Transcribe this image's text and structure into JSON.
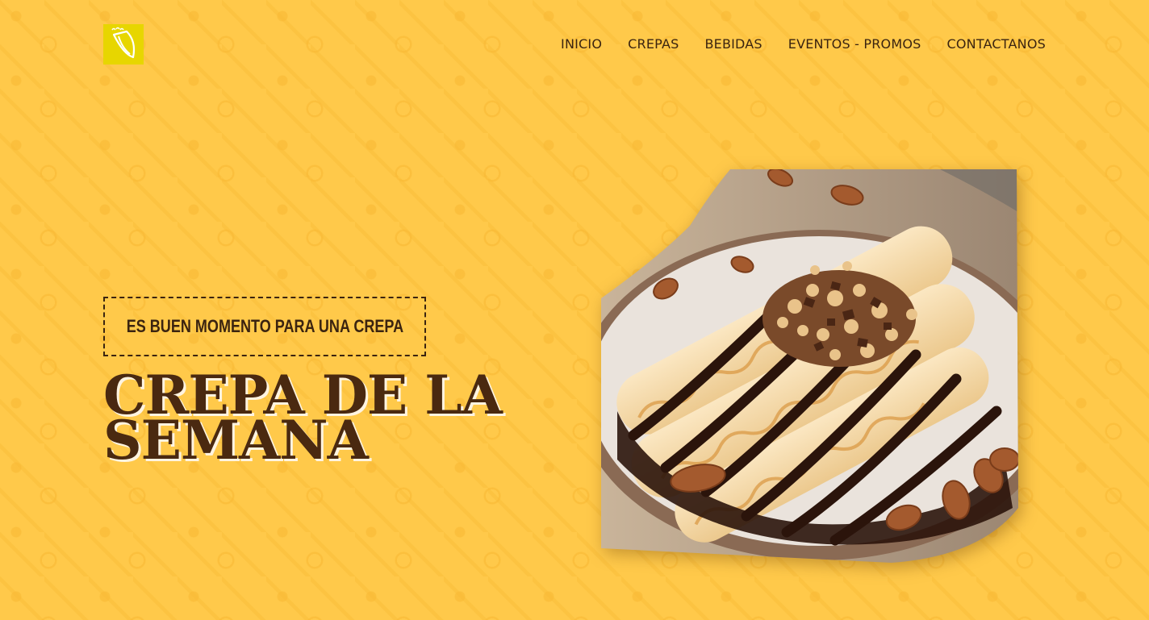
{
  "brand": {
    "logo_icon": "crepe-logo-icon",
    "logo_bg_color": "#e7d600"
  },
  "nav": {
    "items": [
      {
        "label": "INICIO"
      },
      {
        "label": "CREPAS"
      },
      {
        "label": "BEBIDAS"
      },
      {
        "label": "EVENTOS - PROMOS"
      },
      {
        "label": "CONTACTANOS"
      }
    ]
  },
  "hero": {
    "tagline": "ES BUEN MOMENTO PARA UNA CREPA",
    "headline_line1": "CREPA DE LA",
    "headline_line2": "SEMANA",
    "image_icon": "crepe-chocolate-almond-photo"
  },
  "colors": {
    "background": "#ffc94a",
    "text_dark": "#3b2410",
    "headline": "#4a2910"
  }
}
